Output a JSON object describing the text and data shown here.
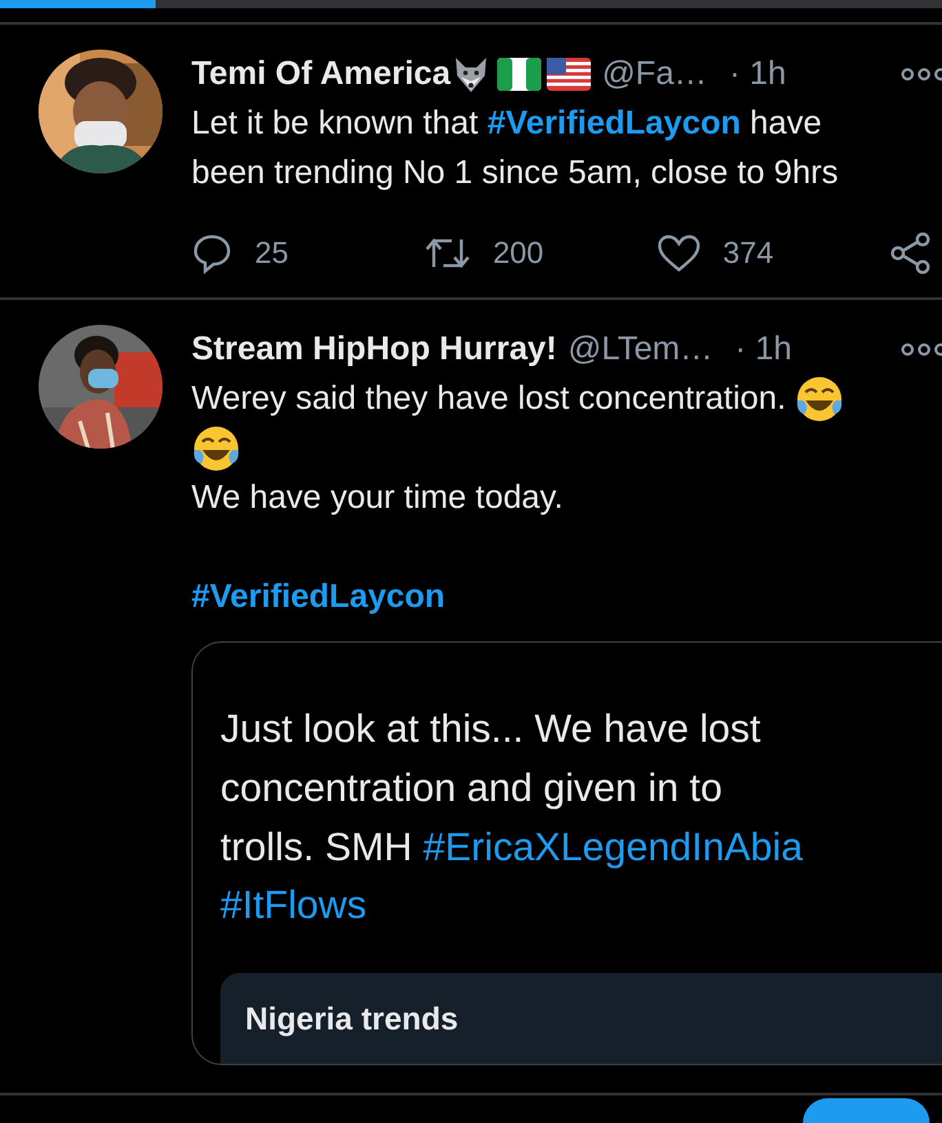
{
  "top_bar": {
    "level": 0.165
  },
  "tweets": [
    {
      "avatar": {
        "kind": "picture"
      },
      "name": "Temi Of America",
      "name_icons": [
        {
          "kind": "wolf"
        },
        {
          "kind": "flag_ng"
        },
        {
          "kind": "flag_us"
        }
      ],
      "handle": "@Fa…",
      "time": "· 1h",
      "body": [
        [
          [
            {
              "kind": "text",
              "text": "Let it be known that "
            },
            {
              "kind": "hashtag",
              "text": "#VerifiedLaycon"
            },
            {
              "kind": "text",
              "text": " have"
            }
          ],
          [
            {
              "kind": "text",
              "text": "been trending No 1 since 5am, close to 9hrs"
            }
          ]
        ]
      ],
      "actions": [
        {
          "kind": "reply",
          "count": "25"
        },
        {
          "kind": "retweet",
          "count": "200"
        },
        {
          "kind": "like",
          "count": "374"
        },
        {
          "kind": "share"
        }
      ]
    },
    {
      "avatar": {
        "kind": "picture"
      },
      "name": "Stream HipHop Hurray!",
      "handle": "@LTem…",
      "time": "· 1h",
      "body": [
        [
          [
            {
              "kind": "text",
              "text": "Werey said they have lost concentration. "
            },
            {
              "kind": "laugh_emoji"
            }
          ],
          [
            {
              "kind": "laugh_emoji"
            }
          ],
          [
            {
              "kind": "text",
              "text": "We have your time today."
            }
          ]
        ],
        [
          [
            {
              "kind": "hashtag",
              "text": "#VerifiedLaycon"
            }
          ]
        ]
      ],
      "quote": {
        "body": [
          [
            [
              {
                "kind": "text",
                "text": "Just look at this... We have lost"
              }
            ],
            [
              {
                "kind": "text",
                "text": "concentration and given in to"
              }
            ],
            [
              {
                "kind": "text",
                "text": "trolls. SMH "
              },
              {
                "kind": "hashtag",
                "text": "#EricaXLegendInAbia"
              }
            ],
            [
              {
                "kind": "hashtag",
                "text": "#ItFlows"
              }
            ]
          ]
        ],
        "card": {
          "title": "Nigeria trends"
        }
      }
    }
  ]
}
